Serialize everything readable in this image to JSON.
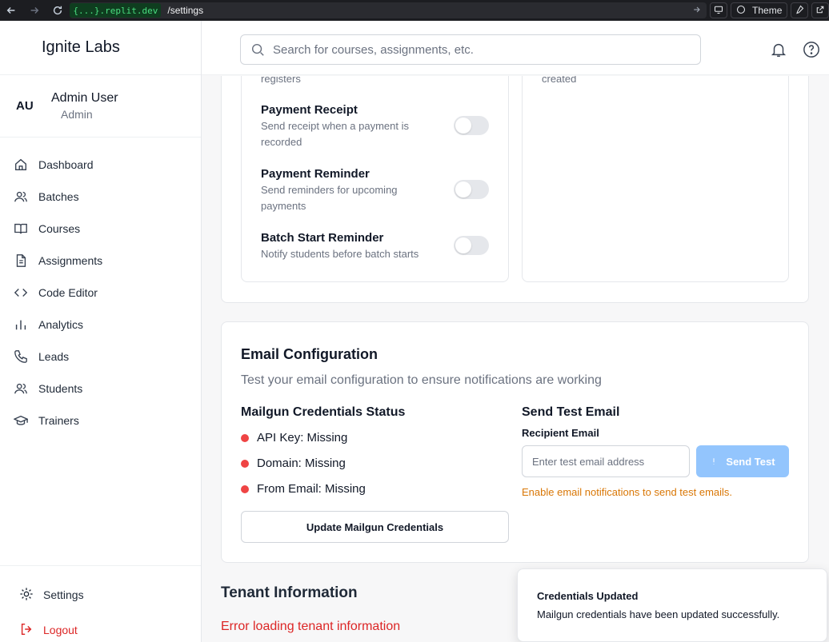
{
  "browser": {
    "domain": "{...}.replit.dev",
    "path": "/settings",
    "theme_label": "Theme"
  },
  "sidebar": {
    "brand": "Ignite Labs",
    "user": {
      "initials": "AU",
      "name": "Admin User",
      "role": "Admin"
    },
    "items": [
      {
        "label": "Dashboard",
        "icon": "home-icon"
      },
      {
        "label": "Batches",
        "icon": "users-icon"
      },
      {
        "label": "Courses",
        "icon": "book-icon"
      },
      {
        "label": "Assignments",
        "icon": "file-icon"
      },
      {
        "label": "Code Editor",
        "icon": "code-icon"
      },
      {
        "label": "Analytics",
        "icon": "bar-chart-icon"
      },
      {
        "label": "Leads",
        "icon": "phone-icon"
      },
      {
        "label": "Students",
        "icon": "users-icon"
      },
      {
        "label": "Trainers",
        "icon": "graduation-cap-icon"
      }
    ],
    "settings_label": "Settings",
    "logout_label": "Logout"
  },
  "header": {
    "search_placeholder": "Search for courses, assignments, etc."
  },
  "notifications": {
    "cut_left_text": "registers",
    "cut_right_text": "created",
    "items": [
      {
        "title": "Payment Receipt",
        "desc": "Send receipt when a payment is recorded",
        "enabled": false
      },
      {
        "title": "Payment Reminder",
        "desc": "Send reminders for upcoming payments",
        "enabled": false
      },
      {
        "title": "Batch Start Reminder",
        "desc": "Notify students before batch starts",
        "enabled": false
      }
    ]
  },
  "email_config": {
    "title": "Email Configuration",
    "subtitle": "Test your email configuration to ensure notifications are working",
    "status_heading": "Mailgun Credentials Status",
    "status_items": [
      {
        "label": "API Key: Missing",
        "color": "#ef4444"
      },
      {
        "label": "Domain: Missing",
        "color": "#ef4444"
      },
      {
        "label": "From Email: Missing",
        "color": "#ef4444"
      }
    ],
    "update_button": "Update Mailgun Credentials",
    "test_heading": "Send Test Email",
    "recipient_label": "Recipient Email",
    "recipient_placeholder": "Enter test email address",
    "send_button": "Send Test",
    "warning": "Enable email notifications to send test emails."
  },
  "tenant": {
    "title": "Tenant Information",
    "error": "Error loading tenant information"
  },
  "toast": {
    "title": "Credentials Updated",
    "message": "Mailgun credentials have been updated successfully."
  },
  "colors": {
    "accent_disabled": "#93c5fd",
    "error": "#dc2626",
    "warning": "#d97706"
  }
}
